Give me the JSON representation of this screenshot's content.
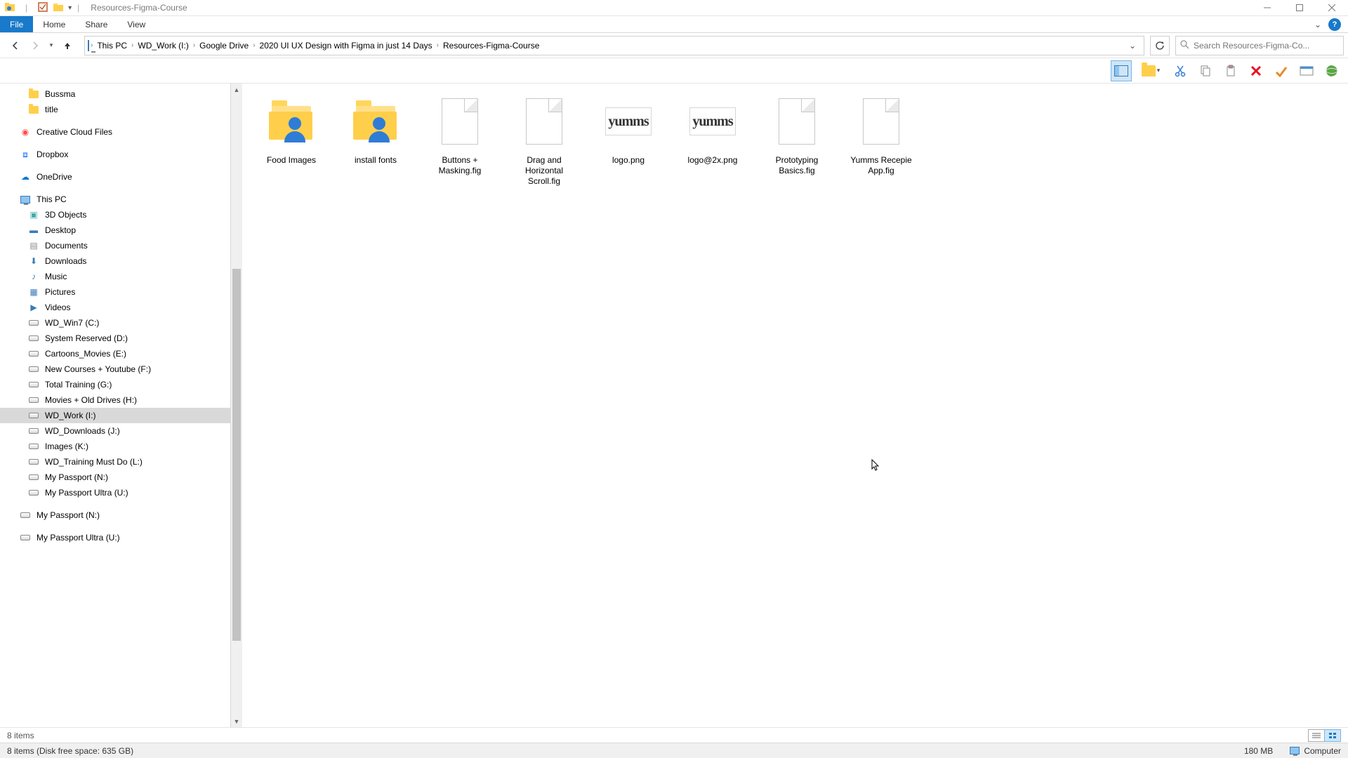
{
  "window": {
    "title": "Resources-Figma-Course"
  },
  "ribbon": {
    "tabs": [
      "File",
      "Home",
      "Share",
      "View"
    ]
  },
  "breadcrumbs": [
    "This PC",
    "WD_Work (I:)",
    "Google Drive",
    "2020 UI UX Design with Figma in just 14 Days",
    "Resources-Figma-Course"
  ],
  "search": {
    "placeholder": "Search Resources-Figma-Co..."
  },
  "nav": {
    "top": [
      {
        "label": "Bussma",
        "icon": "folder"
      },
      {
        "label": "title",
        "icon": "folder"
      }
    ],
    "cloud": [
      {
        "label": "Creative Cloud Files",
        "icon": "cc"
      },
      {
        "label": "Dropbox",
        "icon": "dropbox"
      },
      {
        "label": "OneDrive",
        "icon": "onedrive"
      }
    ],
    "thispc_label": "This PC",
    "thispc_children": [
      {
        "label": "3D Objects",
        "icon": "3d"
      },
      {
        "label": "Desktop",
        "icon": "desktop"
      },
      {
        "label": "Documents",
        "icon": "docs"
      },
      {
        "label": "Downloads",
        "icon": "downloads"
      },
      {
        "label": "Music",
        "icon": "music"
      },
      {
        "label": "Pictures",
        "icon": "pictures"
      },
      {
        "label": "Videos",
        "icon": "videos"
      },
      {
        "label": "WD_Win7 (C:)",
        "icon": "drive"
      },
      {
        "label": "System Reserved (D:)",
        "icon": "drive"
      },
      {
        "label": "Cartoons_Movies (E:)",
        "icon": "drive"
      },
      {
        "label": "New Courses + Youtube (F:)",
        "icon": "drive"
      },
      {
        "label": "Total Training (G:)",
        "icon": "drive"
      },
      {
        "label": "Movies + Old Drives (H:)",
        "icon": "drive"
      },
      {
        "label": "WD_Work (I:)",
        "icon": "drive",
        "selected": true
      },
      {
        "label": "WD_Downloads (J:)",
        "icon": "drive"
      },
      {
        "label": "Images (K:)",
        "icon": "drive"
      },
      {
        "label": "WD_Training Must Do (L:)",
        "icon": "drive"
      },
      {
        "label": "My Passport (N:)",
        "icon": "drive"
      },
      {
        "label": "My Passport Ultra (U:)",
        "icon": "drive"
      }
    ],
    "bottom": [
      {
        "label": "My Passport (N:)",
        "icon": "drive"
      },
      {
        "label": "My Passport Ultra (U:)",
        "icon": "drive"
      }
    ]
  },
  "files": [
    {
      "name": "Food Images",
      "type": "folder-person"
    },
    {
      "name": "install fonts",
      "type": "folder-person"
    },
    {
      "name": "Buttons + Masking.fig",
      "type": "file"
    },
    {
      "name": "Drag and Horizontal Scroll.fig",
      "type": "file"
    },
    {
      "name": "logo.png",
      "type": "logo"
    },
    {
      "name": "logo@2x.png",
      "type": "logo"
    },
    {
      "name": "Prototyping Basics.fig",
      "type": "file"
    },
    {
      "name": "Yumms Recepie App.fig",
      "type": "file"
    }
  ],
  "status": {
    "items": "8 items",
    "detail": "8 items (Disk free space: 635 GB)",
    "size": "180 MB",
    "location": "Computer"
  },
  "logo_text": "yumms"
}
